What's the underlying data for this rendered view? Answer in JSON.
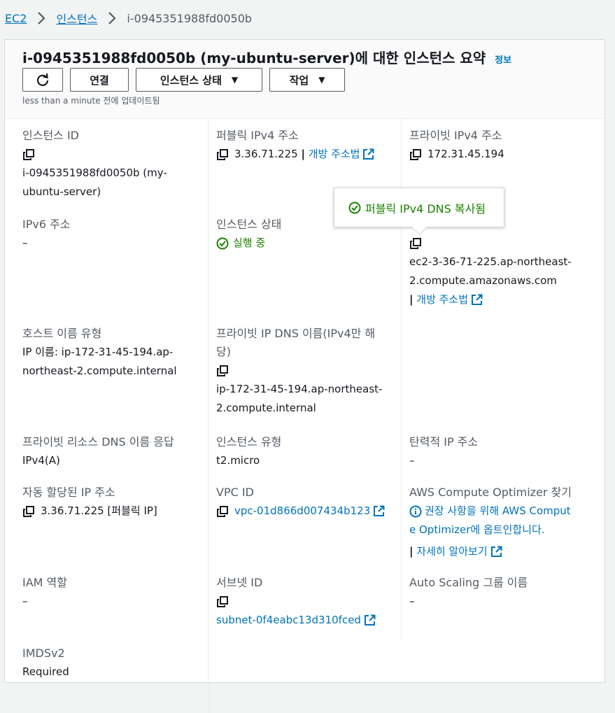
{
  "breadcrumb": {
    "root": "EC2",
    "parent": "인스턴스",
    "current": "i-0945351988fd0050b"
  },
  "header": {
    "title": "i-0945351988fd0050b (my-ubuntu-server)에 대한 인스턴스 요약",
    "info": "정보",
    "buttons": {
      "connect": "연결",
      "instance_state": "인스턴스 상태",
      "actions": "작업"
    },
    "updated": "less than a minute 전에 업데이트됨"
  },
  "tooltip": {
    "text": "퍼블릭 IPv4 DNS 복사됨"
  },
  "fields": {
    "instance_id": {
      "label": "인스턴스 ID",
      "value1": "i-0945351988fd0050b (my-",
      "value2": "ubuntu-server)"
    },
    "public_ipv4": {
      "label": "퍼블릭 IPv4 주소",
      "value": "3.36.71.225",
      "sep": "|",
      "link": "개방 주소법"
    },
    "private_ipv4": {
      "label": "프라이빗 IPv4 주소",
      "value": "172.31.45.194"
    },
    "ipv6": {
      "label": "IPv6 주소",
      "value": "–"
    },
    "instance_state": {
      "label": "인스턴스 상태",
      "value": "실행 중"
    },
    "public_dns": {
      "value1": "ec2-3-36-71-225.ap-northeast-",
      "value2": "2.compute.amazonaws.com",
      "sep": "|",
      "link": "개방 주소법"
    },
    "hostname_type": {
      "label": "호스트 이름 유형",
      "value1": "IP 이름: ip-172-31-45-194.ap-",
      "value2": "northeast-2.compute.internal"
    },
    "private_dns": {
      "label1": "프라이빗 IP DNS 이름(IPv4만 해",
      "label2": "당)",
      "value1": "ip-172-31-45-194.ap-northeast-",
      "value2": "2.compute.internal"
    },
    "resource_dns": {
      "label": "프라이빗 리소스 DNS 이름 응답",
      "value": "IPv4(A)"
    },
    "instance_type": {
      "label": "인스턴스 유형",
      "value": "t2.micro"
    },
    "elastic_ip": {
      "label": "탄력적 IP 주소",
      "value": "–"
    },
    "auto_ip": {
      "label": "자동 할당된 IP 주소",
      "value": "3.36.71.225 [퍼블릭 IP]"
    },
    "vpc": {
      "label": "VPC ID",
      "value": "vpc-01d866d007434b123"
    },
    "optimizer": {
      "label": "AWS Compute Optimizer 찾기",
      "line1": "권장 사항을 위해 AWS Comput",
      "line2": "e Optimizer에 옵트인합니다.",
      "sep": "|",
      "link": "자세히 알아보기"
    },
    "iam": {
      "label": "IAM 역할",
      "value": "–"
    },
    "subnet": {
      "label": "서브넷 ID",
      "value": "subnet-0f4eabc13d310fced"
    },
    "asg": {
      "label": "Auto Scaling 그룹 이름",
      "value": "–"
    },
    "imds": {
      "label": "IMDSv2",
      "value": "Required"
    }
  },
  "colors": {
    "link": "#0073bb",
    "success": "#1d8102",
    "label": "#545b64",
    "text": "#16191f"
  }
}
